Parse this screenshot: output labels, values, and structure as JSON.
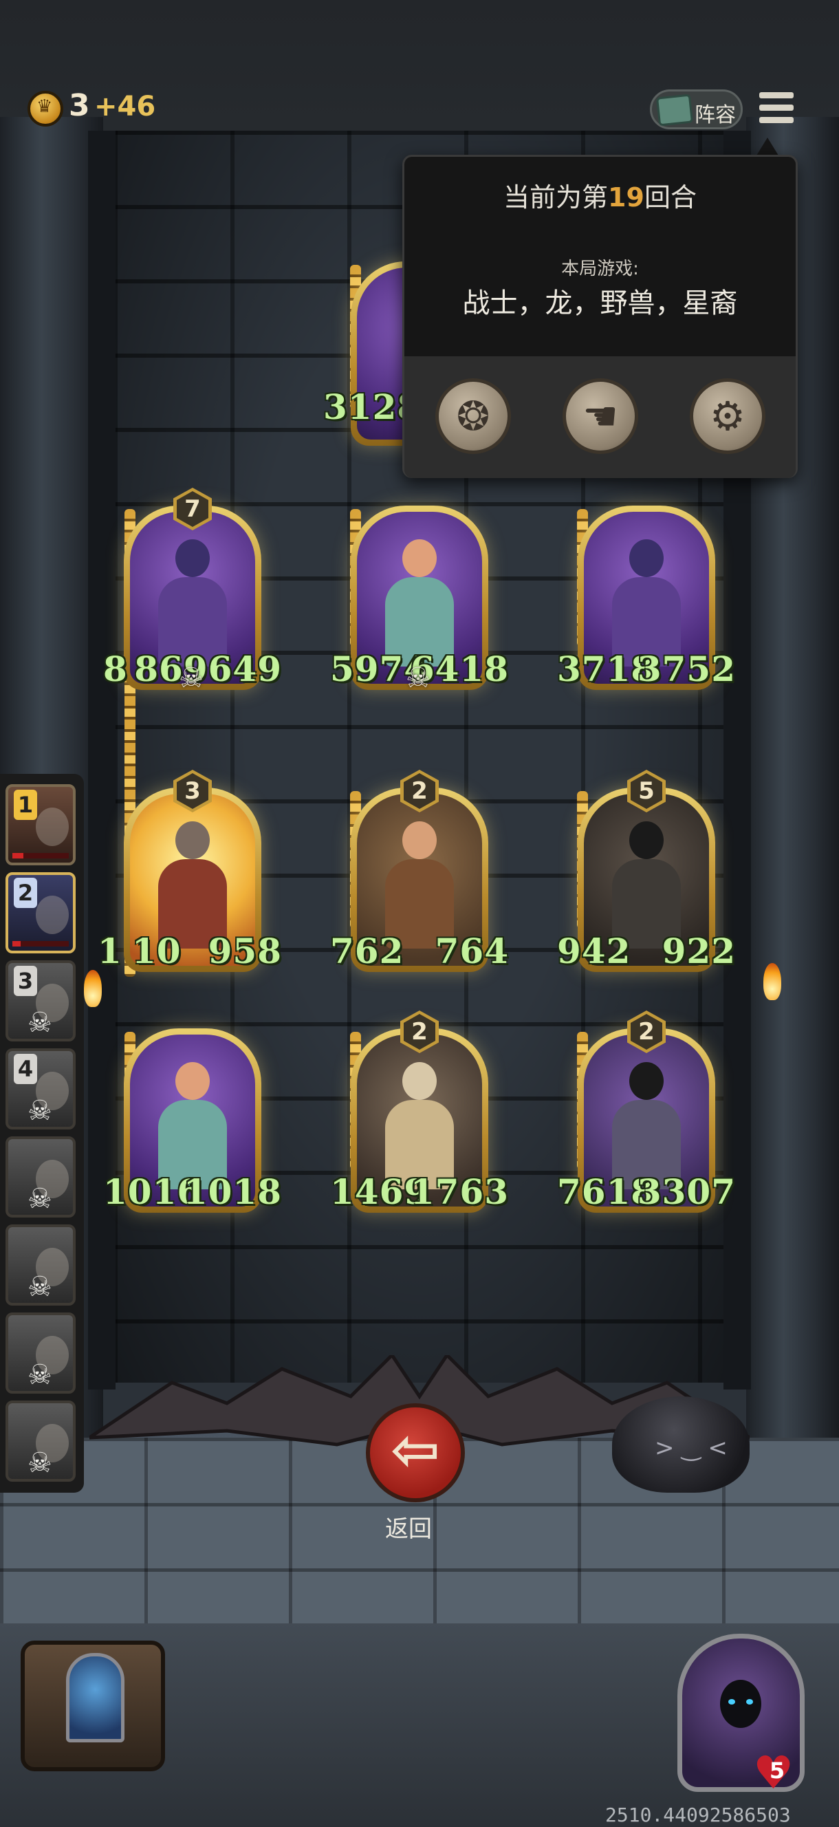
{
  "topbar": {
    "gold": "3",
    "gold_income": "+46",
    "lineup_label": "阵容"
  },
  "round_panel": {
    "title_prefix": "当前为第",
    "round_number": "19",
    "title_suffix": "回合",
    "game_label": "本局游戏:",
    "tribes": "战士，龙，野兽，星裔"
  },
  "board": {
    "top_card": {
      "attack": "3128"
    },
    "rows": [
      [
        {
          "tier": "7",
          "attack": "8",
          "hp": "869649",
          "art": "purple"
        },
        {
          "tier": "",
          "attack": "5974",
          "hp": "6418",
          "art": "purple"
        },
        {
          "tier": "",
          "attack": "3718",
          "hp": "3752",
          "art": "purple"
        }
      ],
      [
        {
          "tier": "3",
          "attack": "1",
          "hp": "958",
          "art": "fire",
          "extra_atk": "10"
        },
        {
          "tier": "2",
          "attack": "762",
          "hp": "764",
          "art": "brown"
        },
        {
          "tier": "5",
          "attack": "942",
          "hp": "922",
          "art": "dark"
        }
      ],
      [
        {
          "tier": "",
          "attack": "1016",
          "hp": "1018",
          "art": "purple"
        },
        {
          "tier": "2",
          "attack": "1469",
          "hp": "1763",
          "art": "gold"
        },
        {
          "tier": "2",
          "attack": "7618",
          "hp": "3307",
          "art": "violet"
        }
      ]
    ]
  },
  "opponents": [
    {
      "rank": "1",
      "state": "alive",
      "hp_fraction": 0.2
    },
    {
      "rank": "2",
      "state": "current",
      "hp_fraction": 0.15
    },
    {
      "rank": "3",
      "state": "dead"
    },
    {
      "rank": "4",
      "state": "dead"
    },
    {
      "rank": "",
      "state": "dead"
    },
    {
      "rank": "",
      "state": "dead"
    },
    {
      "rank": "",
      "state": "dead"
    },
    {
      "rank": "",
      "state": "dead"
    }
  ],
  "back_button": {
    "label": "返回"
  },
  "hero": {
    "health": "5"
  },
  "debug": {
    "version": "2510.44092586503"
  },
  "colors": {
    "stat_text": "#c4f29c",
    "round_accent": "#e3a43c",
    "gold_frame": "#c29a3a",
    "back_button": "#b8281f"
  },
  "icons": {
    "gold": "crown-coin-icon",
    "lineup": "book-card-icon",
    "menu": "hamburger-menu-icon",
    "book": "rule-book-icon",
    "emote": "emote-hand-icon",
    "settings": "gear-icon",
    "back": "arrow-left-icon",
    "skull": "skull-icon",
    "heart": "heart-icon"
  }
}
